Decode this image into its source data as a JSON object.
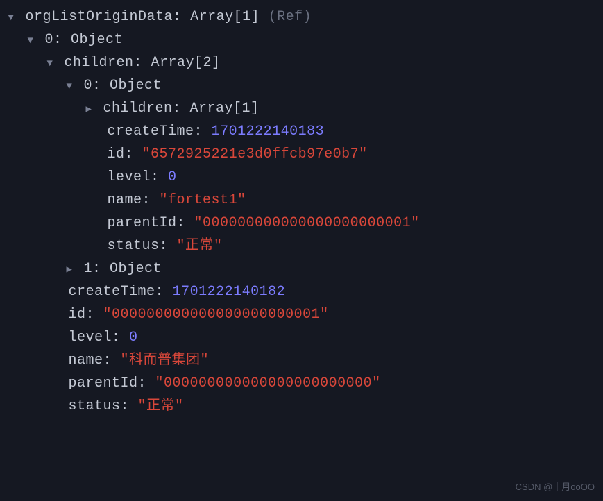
{
  "root": {
    "key": "orgListOriginData",
    "type": "Array[1]",
    "ref": "(Ref)"
  },
  "level1": {
    "index0": {
      "key": "0",
      "type": "Object"
    }
  },
  "level2": {
    "children": {
      "key": "children",
      "type": "Array[2]"
    }
  },
  "level3": {
    "index0": {
      "key": "0",
      "type": "Object"
    },
    "index1": {
      "key": "1",
      "type": "Object"
    }
  },
  "level4": {
    "children": {
      "key": "children",
      "type": "Array[1]"
    },
    "createTime": {
      "key": "createTime",
      "value": "1701222140183"
    },
    "id": {
      "key": "id",
      "value": "\"6572925221e3d0ffcb97e0b7\""
    },
    "level": {
      "key": "level",
      "value": "0"
    },
    "name": {
      "key": "name",
      "value": "\"fortest1\""
    },
    "parentId": {
      "key": "parentId",
      "value": "\"000000000000000000000001\""
    },
    "status": {
      "key": "status",
      "value": "\"正常\""
    }
  },
  "level2b": {
    "createTime": {
      "key": "createTime",
      "value": "1701222140182"
    },
    "id": {
      "key": "id",
      "value": "\"000000000000000000000001\""
    },
    "level": {
      "key": "level",
      "value": "0"
    },
    "name": {
      "key": "name",
      "value": "\"科而普集团\""
    },
    "parentId": {
      "key": "parentId",
      "value": "\"000000000000000000000000\""
    },
    "status": {
      "key": "status",
      "value": "\"正常\""
    }
  },
  "watermark": "CSDN @十月ooOO"
}
